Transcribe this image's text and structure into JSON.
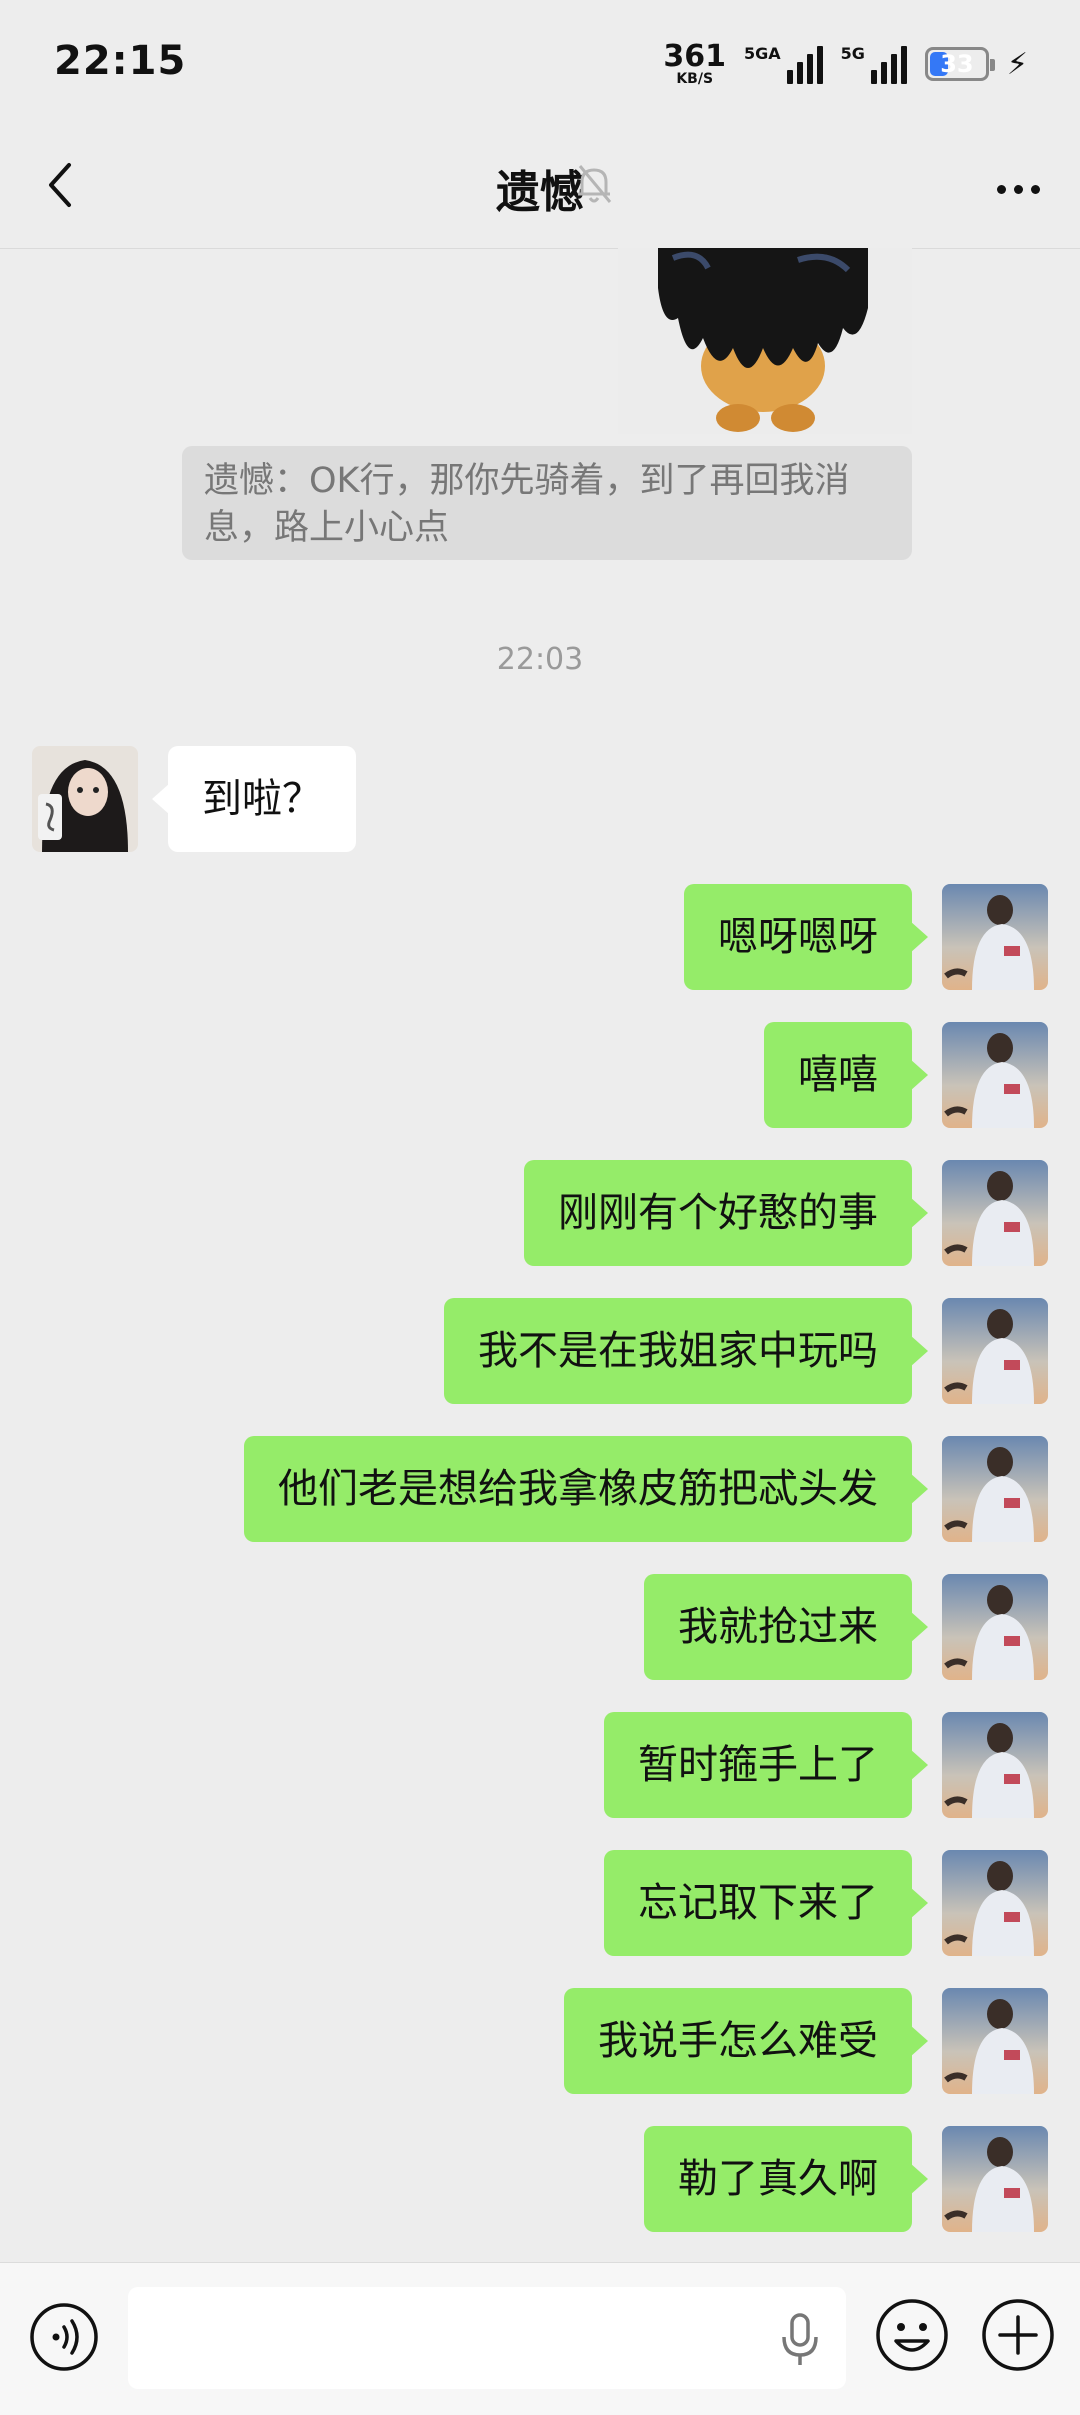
{
  "status_bar": {
    "time": "22:15",
    "net_speed": "361",
    "net_speed_unit": "KB/S",
    "signal1_label": "5GA",
    "signal2_label": "5G",
    "battery": "33",
    "battery_fraction": 0.33,
    "colors": {
      "battery_fill": "#3478f6"
    }
  },
  "header": {
    "title": "遗憾",
    "back_icon": "chevron-left-icon",
    "mute_icon": "bell-off-icon",
    "more_icon": "ellipsis-icon"
  },
  "chat": {
    "quote_text": "遗憾：OK行，那你先骑着，到了再回我消息，路上小心点",
    "timestamp": "22:03",
    "incoming": [
      {
        "text": "到啦？"
      }
    ],
    "outgoing": [
      {
        "text": "嗯呀嗯呀"
      },
      {
        "text": "嘻嘻"
      },
      {
        "text": "刚刚有个好憨的事"
      },
      {
        "text": "我不是在我姐家中玩吗"
      },
      {
        "text": "他们老是想给我拿橡皮筋把忒头发"
      },
      {
        "text": "我就抢过来"
      },
      {
        "text": "暂时箍手上了"
      },
      {
        "text": "忘记取下来了"
      },
      {
        "text": "我说手怎么难受"
      },
      {
        "text": "勒了真久啊"
      }
    ],
    "colors": {
      "outgoing_bubble": "#95ec69",
      "incoming_bubble": "#ffffff",
      "background": "#ededed"
    }
  },
  "input_bar": {
    "voice_icon": "voice-toggle-icon",
    "mic_icon": "microphone-icon",
    "emoji_icon": "emoji-icon",
    "plus_icon": "plus-circle-icon"
  }
}
